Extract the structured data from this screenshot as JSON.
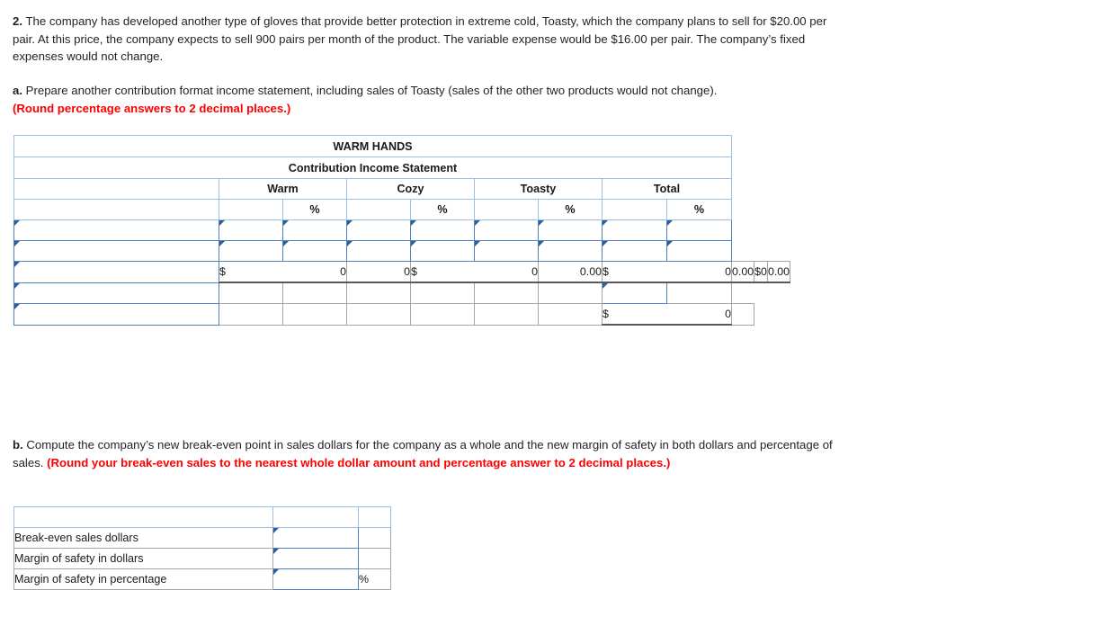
{
  "question": {
    "number": "2.",
    "text": "The company has developed another type of gloves that provide better protection in extreme cold, Toasty, which the company plans to sell for $20.00 per pair. At this price, the company expects to sell 900 pairs per month of the product. The variable expense would be $16.00 per pair. The company’s fixed expenses would not change."
  },
  "part_a": {
    "label": "a.",
    "text": "Prepare another contribution format income statement, including sales of Toasty (sales of the other two products would not change).",
    "instruction": "(Round percentage answers to 2 decimal places.)"
  },
  "part_b": {
    "label": "b.",
    "text": "Compute the company’s new break-even point in sales dollars for the company as a whole and the new margin of safety in both dollars and percentage of sales.",
    "instruction": "(Round your break-even sales to the nearest whole dollar amount and percentage answer to 2 decimal places.)"
  },
  "income_statement": {
    "title": "WARM HANDS",
    "subtitle": "Contribution Income Statement",
    "product_headers": [
      "Warm",
      "Cozy",
      "Toasty",
      "Total"
    ],
    "percent_header": "%",
    "rows": [
      {
        "label": "",
        "type": "input",
        "cells": [
          {
            "type": "input"
          },
          {
            "type": "input"
          },
          {
            "type": "input"
          },
          {
            "type": "input"
          },
          {
            "type": "input"
          },
          {
            "type": "input"
          },
          {
            "type": "input"
          },
          {
            "type": "input"
          }
        ]
      },
      {
        "label": "",
        "type": "input",
        "cells": [
          {
            "type": "input"
          },
          {
            "type": "input"
          },
          {
            "type": "input"
          },
          {
            "type": "input"
          },
          {
            "type": "input"
          },
          {
            "type": "input"
          },
          {
            "type": "input"
          },
          {
            "type": "input"
          }
        ]
      },
      {
        "label": "",
        "type": "input",
        "cells": [
          {
            "type": "value",
            "currency": "$",
            "amount": "0"
          },
          {
            "type": "value",
            "currency": "",
            "amount": "0"
          },
          {
            "type": "value",
            "currency": "$",
            "amount": "0"
          },
          {
            "type": "value",
            "currency": "",
            "amount": "0.00"
          },
          {
            "type": "value",
            "currency": "$",
            "amount": "0"
          },
          {
            "type": "value",
            "currency": "",
            "amount": "0.00"
          },
          {
            "type": "value",
            "currency": "$",
            "amount": "0"
          },
          {
            "type": "value",
            "currency": "",
            "amount": "0.00"
          }
        ]
      },
      {
        "label": "",
        "type": "input",
        "cells": [
          {
            "type": "blank"
          },
          {
            "type": "blank"
          },
          {
            "type": "blank"
          },
          {
            "type": "blank"
          },
          {
            "type": "blank"
          },
          {
            "type": "blank"
          },
          {
            "type": "input"
          },
          {
            "type": "blank"
          }
        ]
      },
      {
        "label": "",
        "type": "input",
        "cells": [
          {
            "type": "blank"
          },
          {
            "type": "blank"
          },
          {
            "type": "blank"
          },
          {
            "type": "blank"
          },
          {
            "type": "blank"
          },
          {
            "type": "blank"
          },
          {
            "type": "value",
            "currency": "$",
            "amount": "0"
          },
          {
            "type": "blank"
          }
        ]
      }
    ]
  },
  "breakeven_table": {
    "header": {
      "label": "",
      "value": "",
      "unit": ""
    },
    "rows": [
      {
        "label": "Break-even sales dollars",
        "value": "",
        "unit": ""
      },
      {
        "label": "Margin of safety in dollars",
        "value": "",
        "unit": ""
      },
      {
        "label": "Margin of safety in percentage",
        "value": "",
        "unit": "%"
      }
    ]
  },
  "colors": {
    "header_blue": "#77abe3",
    "input_border": "#4f81bd",
    "instruction_red": "#ff0000"
  }
}
